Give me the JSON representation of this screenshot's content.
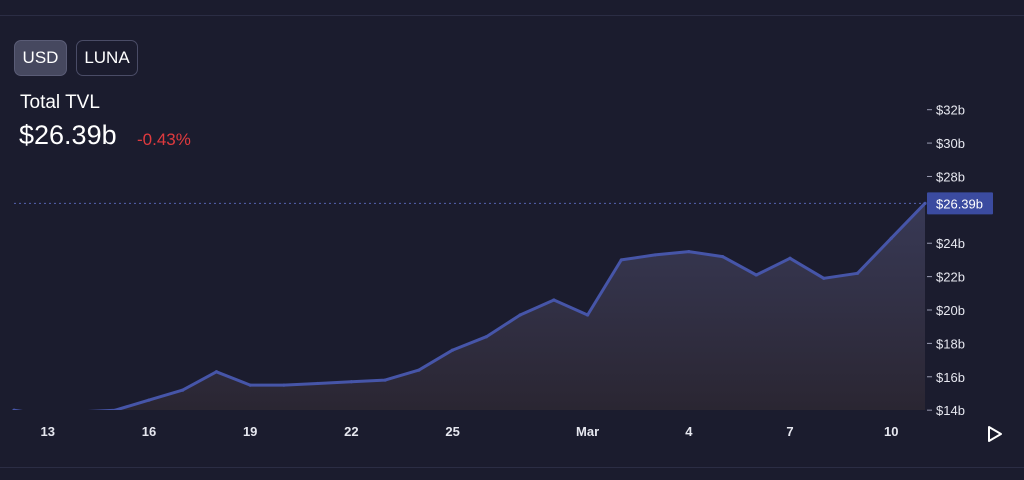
{
  "currency_toggle": {
    "options": [
      "USD",
      "LUNA"
    ],
    "selected": "USD"
  },
  "summary": {
    "label": "Total TVL",
    "value": "$26.39b",
    "change": "-0.43%"
  },
  "colors": {
    "line": "#4655a8",
    "negative": "#e03a3e",
    "badge": "#3b4ba0"
  },
  "icons": {
    "play": "play-icon"
  },
  "chart_data": {
    "type": "area",
    "x": [
      "Feb 12",
      "Feb 13",
      "Feb 14",
      "Feb 15",
      "Feb 16",
      "Feb 17",
      "Feb 18",
      "Feb 19",
      "Feb 20",
      "Feb 21",
      "Feb 22",
      "Feb 23",
      "Feb 24",
      "Feb 25",
      "Feb 26",
      "Feb 27",
      "Feb 28",
      "Mar 1",
      "Mar 2",
      "Mar 3",
      "Mar 4",
      "Mar 5",
      "Mar 6",
      "Mar 7",
      "Mar 8",
      "Mar 9",
      "Mar 10",
      "Mar 11"
    ],
    "series": [
      {
        "values": [
          14.0,
          13.7,
          13.9,
          14.0,
          14.6,
          15.2,
          16.3,
          15.5,
          15.5,
          15.6,
          15.7,
          15.8,
          16.4,
          17.6,
          18.4,
          19.7,
          20.6,
          19.7,
          23.0,
          23.3,
          23.5,
          23.2,
          22.1,
          23.1,
          21.9,
          22.2,
          24.3,
          26.39
        ]
      }
    ],
    "x_ticks": [
      {
        "label": "13",
        "index": 1
      },
      {
        "label": "16",
        "index": 4
      },
      {
        "label": "19",
        "index": 7
      },
      {
        "label": "22",
        "index": 10
      },
      {
        "label": "25",
        "index": 13
      },
      {
        "label": "Mar",
        "index": 17
      },
      {
        "label": "4",
        "index": 20
      },
      {
        "label": "7",
        "index": 23
      },
      {
        "label": "10",
        "index": 26
      }
    ],
    "y_ticks": [
      {
        "label": "$32b",
        "value": 32
      },
      {
        "label": "$30b",
        "value": 30
      },
      {
        "label": "$28b",
        "value": 28
      },
      {
        "label": "$24b",
        "value": 24
      },
      {
        "label": "$22b",
        "value": 22
      },
      {
        "label": "$20b",
        "value": 20
      },
      {
        "label": "$18b",
        "value": 18
      },
      {
        "label": "$16b",
        "value": 16
      },
      {
        "label": "$14b",
        "value": 14
      }
    ],
    "last_value_label": "$26.39b",
    "last_value": 26.39,
    "ylim": [
      13.95,
      33.0
    ],
    "grid": false,
    "legend": "none"
  }
}
